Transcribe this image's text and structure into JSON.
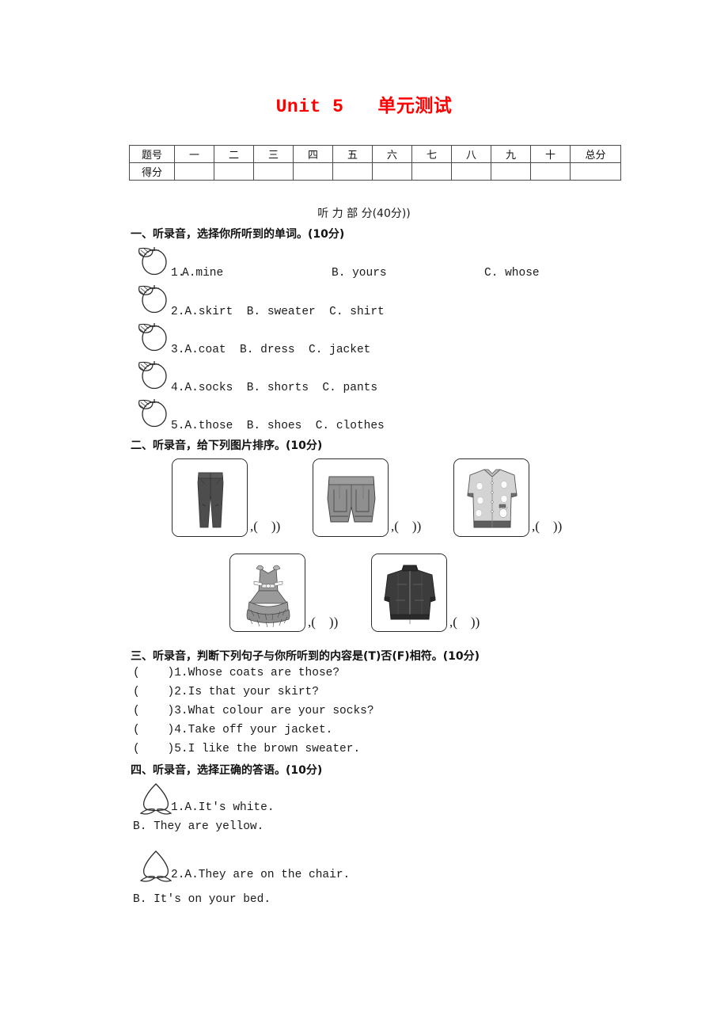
{
  "document": {
    "title_en": "Unit 5",
    "title_cn": "单元测试"
  },
  "score_table": {
    "row_label_1": "题号",
    "row_label_2": "得分",
    "columns": [
      "一",
      "二",
      "三",
      "四",
      "五",
      "六",
      "七",
      "八",
      "九",
      "十",
      "总分"
    ]
  },
  "listening_part": {
    "heading": "听 力 部 分(40分))"
  },
  "sections": {
    "s1": {
      "label": "一、听录音，选择你所听到的单词。(10分)",
      "items": [
        {
          "n": "1.",
          "a": "A.mine",
          "b": "B. yours",
          "c": "C. whose"
        },
        {
          "n": "2.",
          "text": "2.A.skirt  B. sweater  C. shirt"
        },
        {
          "n": "3.",
          "text": "3.A.coat  B. dress  C. jacket"
        },
        {
          "n": "4.",
          "text": "4.A.socks  B. shorts  C. pants"
        },
        {
          "n": "5.",
          "text": "5.A.those  B. shoes  C. clothes"
        }
      ],
      "item1_num": "1.",
      "item1_a": "A.mine",
      "item1_b": "B. yours",
      "item1_c": "C. whose"
    },
    "s2": {
      "label": "二、听录音，给下列图片排序。(10分)",
      "pictures": [
        {
          "name": "pants",
          "paren": ",(    ))"
        },
        {
          "name": "shorts",
          "paren": ",(    ))"
        },
        {
          "name": "cardigan",
          "paren": ",(    ))"
        },
        {
          "name": "dress",
          "paren": ",(    ))"
        },
        {
          "name": "jacket",
          "paren": ",(    ))"
        }
      ]
    },
    "s3": {
      "label": "三、听录音，判断下列句子与你所听到的内容是(T)否(F)相符。(10分)",
      "lines": [
        "(    )1.Whose coats are those?",
        "(    )2.Is that your skirt?",
        "(    )3.What colour are your socks?",
        "(    )4.Take off your jacket.",
        "(    )5.I like the brown sweater."
      ]
    },
    "s4": {
      "label": "四、听录音，选择正确的答语。(10分)",
      "q1_a": "1.A.It's white.",
      "q1_b": "B. They are yellow.",
      "q2_a": "2.A.They are on the chair.",
      "q2_b": "B. It's on your bed."
    }
  },
  "colors": {
    "title_red": "#ff0000",
    "text": "#1a1a1a",
    "rule": "#4a4a4a",
    "pants_dark": "#4a4a4a",
    "shorts_gray": "#8c8c8c",
    "cardigan_light": "#d0d0d0",
    "dress_gray": "#9a9a9a",
    "jacket_black": "#3a3a3a"
  }
}
